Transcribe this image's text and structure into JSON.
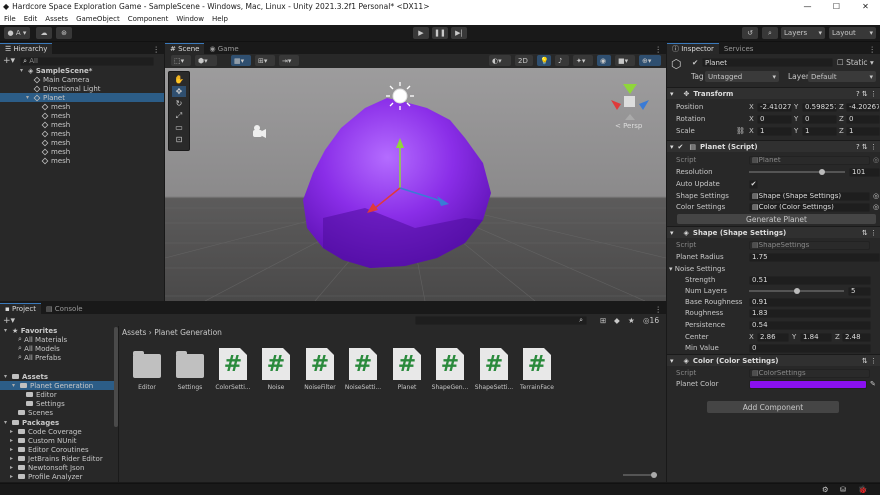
{
  "window": {
    "title": "Hardcore Space Exploration Game - SampleScene - Windows, Mac, Linux - Unity 2021.3.2f1 Personal* <DX11>",
    "controls": [
      "—",
      "☐",
      "✕"
    ]
  },
  "menu": [
    "File",
    "Edit",
    "Assets",
    "GameObject",
    "Component",
    "Window",
    "Help"
  ],
  "toolbar": {
    "account": "A",
    "layers": "Layers",
    "layout": "Layout"
  },
  "hierarchy": {
    "tab": "Hierarchy",
    "search_placeholder": "All",
    "scene": "SampleScene*",
    "items": [
      "Main Camera",
      "Directional Light",
      "Planet",
      "mesh",
      "mesh",
      "mesh",
      "mesh",
      "mesh",
      "mesh",
      "mesh"
    ]
  },
  "scene_view": {
    "tabs": [
      "Scene",
      "Game"
    ],
    "mode_2d": "2D",
    "gizmo_label": "< Persp"
  },
  "project": {
    "tabs": [
      "Project",
      "Console"
    ],
    "badge": "16",
    "breadcrumb": [
      "Assets",
      "Planet Generation"
    ],
    "favorites": {
      "label": "Favorites",
      "items": [
        "All Materials",
        "All Models",
        "All Prefabs"
      ]
    },
    "assets_tree": {
      "label": "Assets",
      "items": [
        "Planet Generation",
        "Editor",
        "Settings",
        "Scenes"
      ]
    },
    "packages": {
      "label": "Packages",
      "items": [
        "Code Coverage",
        "Custom NUnit",
        "Editor Coroutines",
        "JetBrains Rider Editor",
        "Newtonsoft Json",
        "Profile Analyzer"
      ]
    },
    "files": [
      {
        "name": "Editor",
        "kind": "folder"
      },
      {
        "name": "Settings",
        "kind": "folder"
      },
      {
        "name": "ColorSetti...",
        "kind": "script"
      },
      {
        "name": "Noise",
        "kind": "script"
      },
      {
        "name": "NoiseFilter",
        "kind": "script"
      },
      {
        "name": "NoiseSetti...",
        "kind": "script"
      },
      {
        "name": "Planet",
        "kind": "script"
      },
      {
        "name": "ShapeGen...",
        "kind": "script"
      },
      {
        "name": "ShapeSetti...",
        "kind": "script"
      },
      {
        "name": "TerrainFace",
        "kind": "script"
      }
    ]
  },
  "inspector": {
    "tabs": [
      "Inspector",
      "Services"
    ],
    "object_name": "Planet",
    "static_label": "Static",
    "tag_label": "Tag",
    "tag_value": "Untagged",
    "layer_label": "Layer",
    "layer_value": "Default",
    "transform": {
      "title": "Transform",
      "position": {
        "label": "Position",
        "x": "-2.41027",
        "y": "0.598257",
        "z": "-4.20267"
      },
      "rotation": {
        "label": "Rotation",
        "x": "0",
        "y": "0",
        "z": "0"
      },
      "scale": {
        "label": "Scale",
        "x": "1",
        "y": "1",
        "z": "1"
      }
    },
    "planet_script": {
      "title": "Planet (Script)",
      "script_label": "Script",
      "script_value": "Planet",
      "resolution_label": "Resolution",
      "resolution_value": "101",
      "resolution_fraction": 0.78,
      "auto_update_label": "Auto Update",
      "shape_settings_label": "Shape Settings",
      "shape_settings_value": "Shape (Shape Settings)",
      "color_settings_label": "Color Settings",
      "color_settings_value": "Color (Color Settings)",
      "generate_button": "Generate Planet"
    },
    "shape_settings": {
      "title": "Shape (Shape Settings)",
      "script_label": "Script",
      "script_value": "ShapeSettings",
      "radius_label": "Planet Radius",
      "radius_value": "1.75",
      "noise_label": "Noise Settings",
      "strength_label": "Strength",
      "strength_value": "0.51",
      "layers_label": "Num Layers",
      "layers_value": "5",
      "layers_fraction": 0.5,
      "base_rough_label": "Base Roughness",
      "base_rough_value": "0.91",
      "rough_label": "Roughness",
      "rough_value": "1.83",
      "persistence_label": "Persistence",
      "persistence_value": "0.54",
      "center_label": "Center",
      "center_x": "2.86",
      "center_y": "1.84",
      "center_z": "2.48",
      "minvalue_label": "Min Value",
      "minvalue_value": "0"
    },
    "color_settings": {
      "title": "Color (Color Settings)",
      "script_label": "Script",
      "script_value": "ColorSettings",
      "planet_color_label": "Planet Color",
      "planet_color": "#8a10f0"
    },
    "add_component": "Add Component"
  }
}
